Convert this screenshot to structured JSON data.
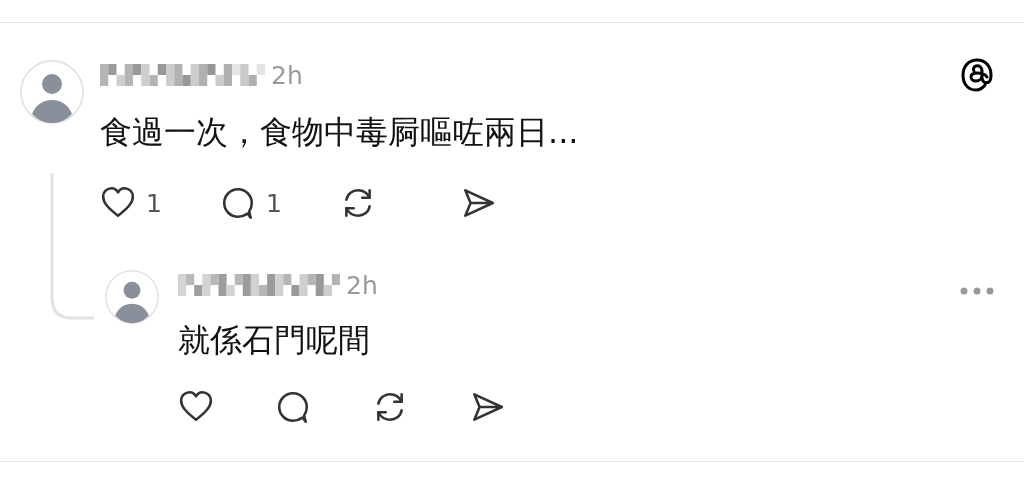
{
  "post": {
    "time": "2h",
    "text": "食過一次，食物中毒屙嘔咗兩日...",
    "corner": {
      "kind": "logo"
    },
    "actions": [
      {
        "kind": "like",
        "count": "1"
      },
      {
        "kind": "comment",
        "count": "1"
      },
      {
        "kind": "repost"
      },
      {
        "kind": "share"
      }
    ]
  },
  "replies": [
    {
      "time": "2h",
      "text": "就係石門呢間",
      "corner": {
        "kind": "more"
      },
      "actions": [
        {
          "kind": "like"
        },
        {
          "kind": "comment"
        },
        {
          "kind": "repost"
        },
        {
          "kind": "share"
        }
      ]
    }
  ]
}
